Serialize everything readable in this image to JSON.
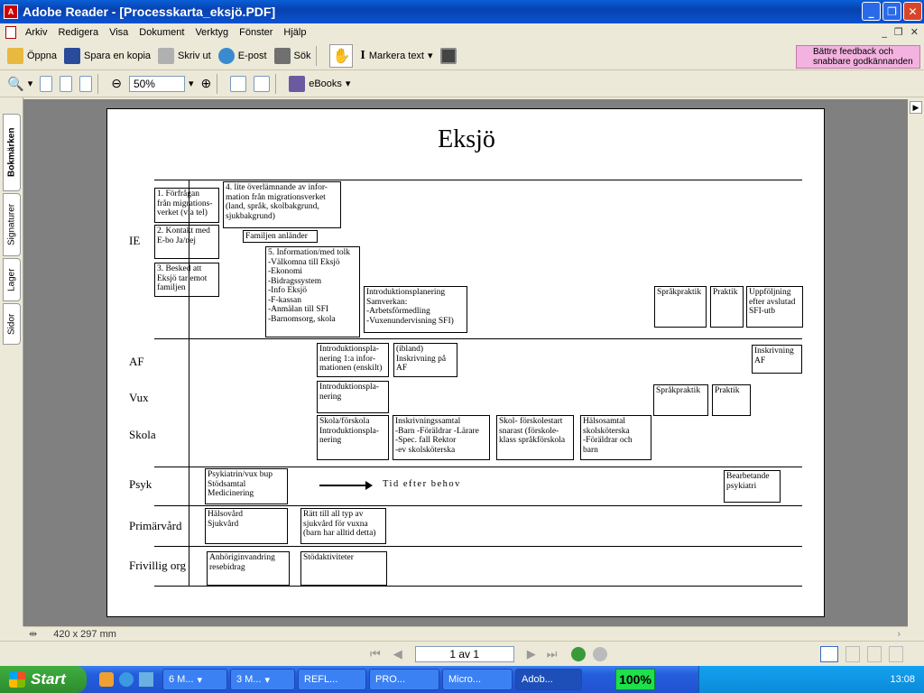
{
  "window": {
    "title": "Adobe Reader - [Processkarta_eksjö.PDF]"
  },
  "menu": [
    "Arkiv",
    "Redigera",
    "Visa",
    "Dokument",
    "Verktyg",
    "Fönster",
    "Hjälp"
  ],
  "toolbar1": {
    "open": "Öppna",
    "save_copy": "Spara en kopia",
    "print": "Skriv ut",
    "email": "E-post",
    "search": "Sök",
    "select_text": "Markera text",
    "feedback": "Bättre feedback och snabbare godkännanden"
  },
  "toolbar2": {
    "zoom": "50%",
    "ebooks": "eBooks"
  },
  "side_tabs": [
    "Bokmärken",
    "Signaturer",
    "Lager",
    "Sidor"
  ],
  "status": {
    "page_size": "420 x 297 mm",
    "page_indicator": "1 av 1"
  },
  "document": {
    "title": "Eksjö",
    "row_labels": [
      "IE",
      "AF",
      "Vux",
      "Skola",
      "Psyk",
      "Primärvård",
      "Frivillig org"
    ],
    "boxes": {
      "ie1": "1. Förfrågan\nfrån migrations-\nverket (via tel)",
      "ie2": "2. Kontakt med\nE-bo Ja/nej",
      "ie3": "3. Besked att\nEksjö tar emot\nfamiljen",
      "ie4": "4. lite överlämnande av infor-\nmation från migrationsverket\n(land, språk, skolbakgrund,\nsjukbakgrund)",
      "ie_arrive": "Familjen anländer",
      "ie5": "5. Information/med tolk\n-Välkomna till Eksjö\n-Ekonomi\n-Bidragssystem\n-Info Eksjö\n-F-kassan\n-Anmälan till SFI\n-Barnomsorg, skola",
      "ie_intro": "Introduktionsplanering\nSamverkan:\n-Arbetsförmedling\n-Vuxenundervisning SFI)",
      "ie_sprak": "Språkpraktik",
      "ie_praktik": "Praktik",
      "ie_uppf": "Uppföljning\nefter avslutad\nSFI-utb",
      "af_intro": "Introduktionspla-\nnering 1:a infor-\nmationen (enskilt)",
      "af_ibland": "(ibland)\nInskrivning på\nAF",
      "af_inskr": "Inskrivning\nAF",
      "vux_intro": "Introduktionspla-\nnering",
      "vux_sprak": "Språkpraktik",
      "vux_praktik": "Praktik",
      "skola1": "Skola/förskola\nIntroduktionspla-\nnering",
      "skola2": "Inskrivningssamtal\n-Barn -Föräldrar -Lärare\n-Spec. fall Rektor\n-ev skolsköterska",
      "skola3": "Skol- förskolestart\nsnarast (förskole-\nklass språkförskola",
      "skola4": "Hälsosamtal\nskolsköterska\n-Föräldrar och\nbarn",
      "psyk1": "Psykiatrin/vux bup\nStödsamtal\nMedicinering",
      "psyk_arrow": "Tid efter behov",
      "psyk2": "Bearbetande\npsykiatri",
      "prim1": "Hälsovård\nSjukvård",
      "prim2": "Rätt till all typ av\nsjukvård för vuxna\n(barn har alltid detta)",
      "friv1": "Anhöriginvandring\nresebidrag",
      "friv2": "Stödaktiviteter"
    }
  },
  "taskbar": {
    "start": "Start",
    "tasks": [
      "6 M...",
      "3 M...",
      "REFL...",
      "PRO...",
      "Micro...",
      "Adob..."
    ],
    "battery": "100%",
    "clock": "13:08"
  }
}
